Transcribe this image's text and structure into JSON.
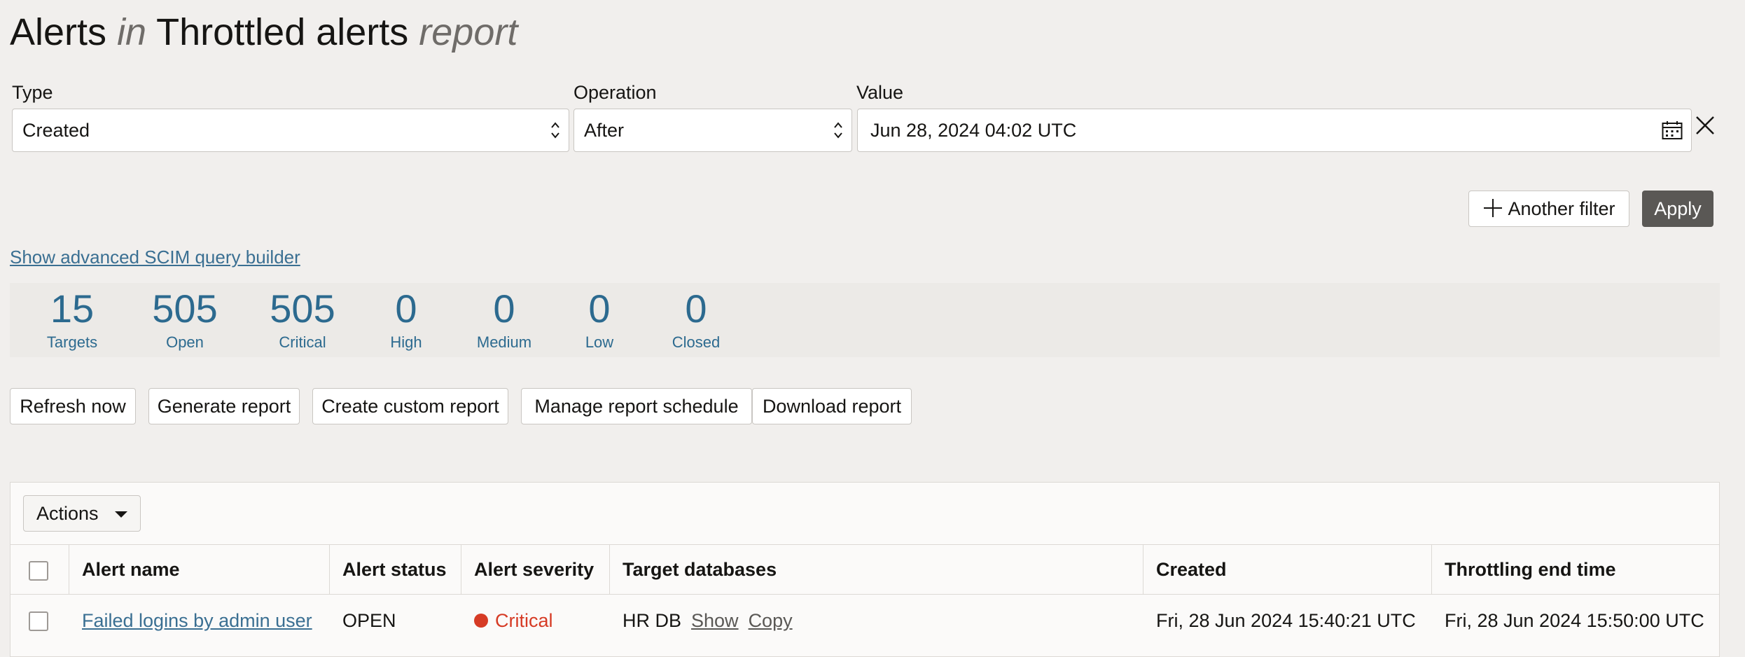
{
  "title": {
    "part1": "Alerts",
    "part2": "in",
    "part3": "Throttled alerts",
    "part4": "report"
  },
  "filter": {
    "type_label": "Type",
    "type_value": "Created",
    "operation_label": "Operation",
    "operation_value": "After",
    "value_label": "Value",
    "value_value": "Jun 28, 2024 04:02 UTC"
  },
  "buttons": {
    "another_filter": "Another filter",
    "apply": "Apply"
  },
  "advanced_link": "Show advanced SCIM query builder",
  "stats": [
    {
      "value": "15",
      "label": "Targets"
    },
    {
      "value": "505",
      "label": "Open"
    },
    {
      "value": "505",
      "label": "Critical"
    },
    {
      "value": "0",
      "label": "High"
    },
    {
      "value": "0",
      "label": "Medium"
    },
    {
      "value": "0",
      "label": "Low"
    },
    {
      "value": "0",
      "label": "Closed"
    }
  ],
  "report_buttons": {
    "refresh": "Refresh now",
    "generate": "Generate report",
    "custom": "Create custom report",
    "schedule": "Manage report schedule",
    "download": "Download report"
  },
  "table": {
    "actions_label": "Actions",
    "columns": [
      "Alert name",
      "Alert status",
      "Alert severity",
      "Target databases",
      "Created",
      "Throttling end time"
    ],
    "rows": [
      {
        "alert_name": "Failed logins by admin user",
        "status": "OPEN",
        "severity": "Critical",
        "target": "HR DB",
        "show": "Show",
        "copy": "Copy",
        "created": "Fri, 28 Jun 2024 15:40:21 UTC",
        "throttling_end": "Fri, 28 Jun 2024 15:50:00 UTC"
      }
    ]
  },
  "colors": {
    "accent": "#2c6a8f",
    "link": "#3a6f92",
    "critical": "#d63b25",
    "primary_button": "#5a5855"
  },
  "icons": [
    "select-spinner-icon",
    "calendar-icon",
    "close-icon",
    "plus-icon",
    "caret-down-icon"
  ]
}
